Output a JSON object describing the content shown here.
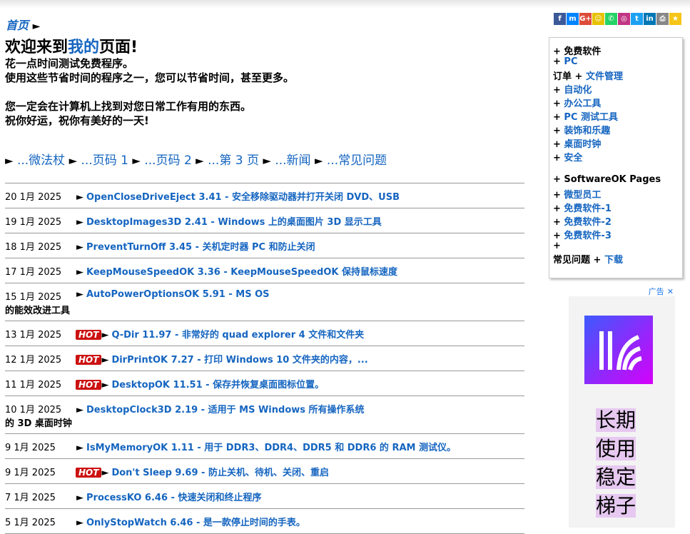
{
  "breadcrumb": {
    "home": "首页",
    "arrow": "►"
  },
  "welcome": {
    "prefix": "欢迎来到",
    "highlight": "我的",
    "suffix": "页面!"
  },
  "intro": {
    "line1": "花一点时间测试免费程序。",
    "line2": "使用这些节省时间的程序之一，您可以节省时间，甚至更多。",
    "line3": "您一定会在计算机上找到对您日常工作有用的东西。",
    "line4": "祝你好运，祝你有美好的一天!"
  },
  "nav_links": [
    "...微法杖",
    "...页码 1",
    "...页码 2",
    "...第 3 页",
    "...新闻",
    "...常见问题"
  ],
  "nav_arrow": "►",
  "news": [
    {
      "date": "20 1月 2025",
      "hot": false,
      "text": "OpenCloseDriveEject 3.41 - 安全移除驱动器并打开关闭 DVD、USB",
      "cont": ""
    },
    {
      "date": "19 1月 2025",
      "hot": false,
      "text": "DesktopImages3D 2.41 - Windows 上的桌面图片 3D 显示工具",
      "cont": ""
    },
    {
      "date": "18 1月 2025",
      "hot": false,
      "text": "PreventTurnOff 3.45 - 关机定时器 PC 和防止关闭",
      "cont": ""
    },
    {
      "date": "17 1月 2025",
      "hot": false,
      "text": "KeepMouseSpeedOK 3.36 - KeepMouseSpeedOK 保持鼠标速度",
      "cont": ""
    },
    {
      "date": "15 1月 2025",
      "hot": false,
      "text": "AutoPowerOptionsOK 5.91 - MS OS",
      "cont": "的能效改进工具"
    },
    {
      "date": "13 1月 2025",
      "hot": true,
      "text": "Q-Dir 11.97 - 非常好的 quad explorer 4 文件和文件夹",
      "cont": ""
    },
    {
      "date": "12 1月 2025",
      "hot": true,
      "text": "DirPrintOK 7.27 - 打印 Windows 10 文件夹的内容，...",
      "cont": ""
    },
    {
      "date": "11 1月 2025",
      "hot": true,
      "text": "DesktopOK 11.51 - 保存并恢复桌面图标位置。",
      "cont": ""
    },
    {
      "date": "10 1月 2025",
      "hot": false,
      "text": "DesktopClock3D 2.19 - 适用于 MS Windows 所有操作系统",
      "cont": "的 3D 桌面时钟"
    },
    {
      "date": "9 1月 2025",
      "hot": false,
      "text": "IsMyMemoryOK 1.11 - 用于 DDR3、DDR4、DDR5 和 DDR6 的 RAM 测试仪。",
      "cont": ""
    },
    {
      "date": "9 1月 2025",
      "hot": true,
      "text": "Don't Sleep 9.69 - 防止关机、待机、关闭、重启",
      "cont": ""
    },
    {
      "date": "7 1月 2025",
      "hot": false,
      "text": "ProcessKO 6.46 - 快速关闭和终止程序",
      "cont": ""
    },
    {
      "date": "5 1月 2025",
      "hot": false,
      "text": "OnlyStopWatch 6.46 - 是一款停止时间的手表。",
      "cont": ""
    }
  ],
  "hot_label": "HOT",
  "news_arrow": "►",
  "social_icons": [
    {
      "name": "facebook-icon",
      "glyph": "f",
      "color": "#3b5998"
    },
    {
      "name": "messenger-icon",
      "glyph": "m",
      "color": "#0084ff"
    },
    {
      "name": "google-plus-icon",
      "glyph": "G+",
      "color": "#dd4b39"
    },
    {
      "name": "snapchat-icon",
      "glyph": "☺",
      "color": "#e6c200"
    },
    {
      "name": "whatsapp-icon",
      "glyph": "✆",
      "color": "#25d366"
    },
    {
      "name": "instagram-icon",
      "glyph": "◎",
      "color": "#c13584"
    },
    {
      "name": "twitter-icon",
      "glyph": "t",
      "color": "#1da1f2"
    },
    {
      "name": "linkedin-icon",
      "glyph": "in",
      "color": "#0077b5"
    },
    {
      "name": "print-icon",
      "glyph": "⎙",
      "color": "#888888"
    },
    {
      "name": "bookmark-star-icon",
      "glyph": "★",
      "color": "#f5c518"
    }
  ],
  "sidebar": {
    "items": [
      {
        "prefix": "+ ",
        "label": "免费软件",
        "link": false
      },
      {
        "prefix": "+ ",
        "label": "PC",
        "link": true
      },
      {
        "prefix": "订单 + ",
        "label": "文件管理",
        "link": true
      },
      {
        "prefix": "+ ",
        "label": "自动化",
        "link": true
      },
      {
        "prefix": "+ ",
        "label": "办公工具",
        "link": true
      },
      {
        "prefix": "+ ",
        "label": "PC 测试工具",
        "link": true
      },
      {
        "prefix": "+ ",
        "label": "装饰和乐趣",
        "link": true
      },
      {
        "prefix": "+ ",
        "label": "桌面时钟",
        "link": true
      },
      {
        "prefix": "+ ",
        "label": "安全",
        "link": true
      },
      {
        "prefix": "+ ",
        "label": "SoftwareOK Pages",
        "link": false
      },
      {
        "prefix": "+ ",
        "label": "微型员工",
        "link": true
      },
      {
        "prefix": "+ ",
        "label": "免费软件-1",
        "link": true
      },
      {
        "prefix": "+ ",
        "label": "免费软件-2",
        "link": true
      },
      {
        "prefix": "+ ",
        "label": "免费软件-3",
        "link": true
      },
      {
        "prefix": "+",
        "label": "",
        "link": false
      },
      {
        "prefix": "常见问题 + ",
        "label": "下载",
        "link": true
      }
    ]
  },
  "ad": {
    "label": "广告",
    "close": "✕",
    "text_lines": [
      "长期",
      "使用",
      "稳定",
      "梯子"
    ]
  }
}
